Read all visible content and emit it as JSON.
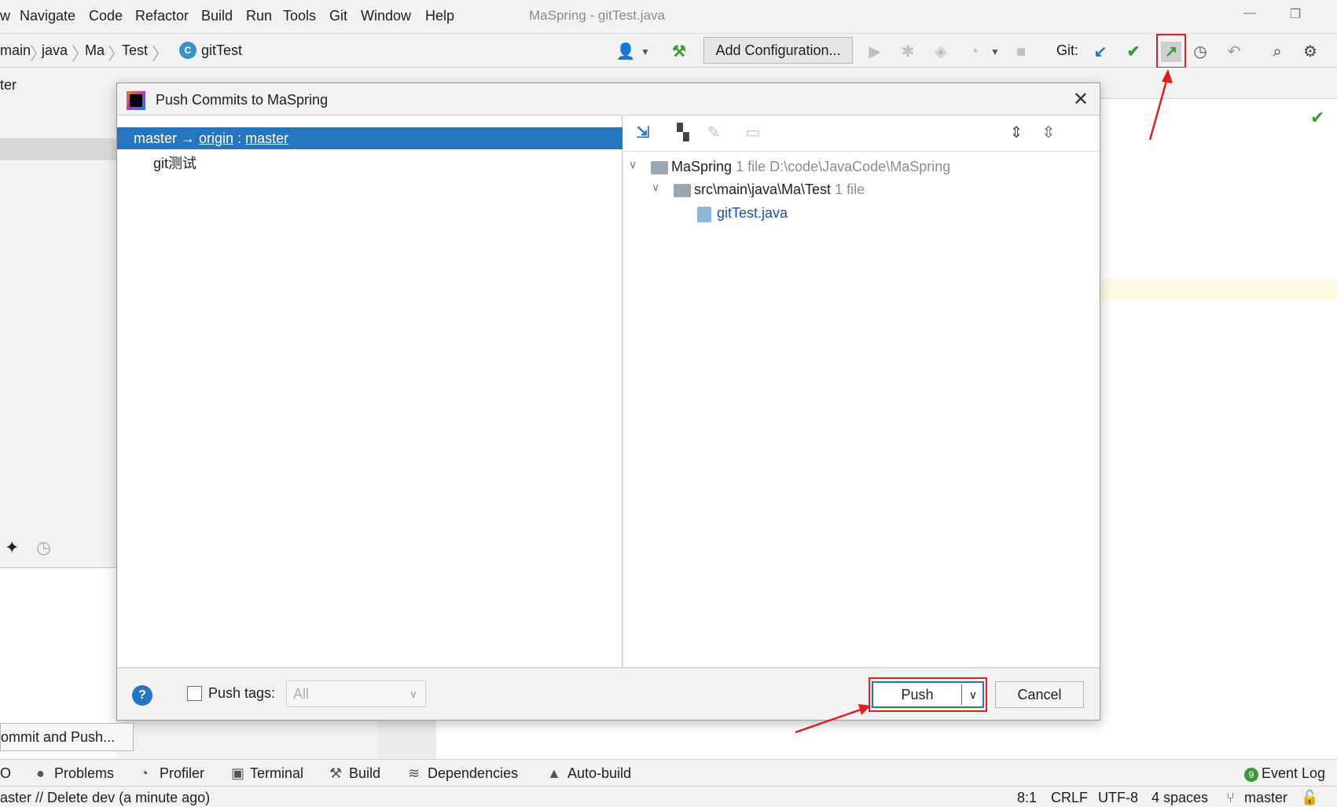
{
  "menu": {
    "items": [
      "w",
      "Navigate",
      "Code",
      "Refactor",
      "Build",
      "Run",
      "Tools",
      "Git",
      "Window",
      "Help"
    ],
    "window_title": "MaSpring - gitTest.java"
  },
  "breadcrumb": {
    "items": [
      "main",
      "java",
      "Ma",
      "Test",
      "gitTest"
    ]
  },
  "toolbar": {
    "add_configuration": "Add Configuration...",
    "git_label": "Git:"
  },
  "left_panel": {
    "tab_partial": "ter"
  },
  "dialog": {
    "title": "Push Commits to MaSpring",
    "branch": {
      "local": "master",
      "arrow": " → ",
      "remote": "origin",
      "colon": " : ",
      "remote_branch": "master"
    },
    "commits": [
      "git测试"
    ],
    "tree": {
      "root_name": "MaSpring",
      "root_count": "1 file",
      "root_path": "D:\\code\\JavaCode\\MaSpring",
      "folder_name": "src\\main\\java\\Ma\\Test",
      "folder_count": "1 file",
      "file_name": "gitTest.java"
    },
    "push_tags_label": "Push tags:",
    "push_tags_value": "All",
    "push_tags_checked": false,
    "push_button": "Push",
    "cancel_button": "Cancel"
  },
  "commit_and_push": "ommit and Push...",
  "tool_windows": {
    "items": [
      "O",
      "Problems",
      "Profiler",
      "Terminal",
      "Build",
      "Dependencies",
      "Auto-build"
    ],
    "event_log": "Event Log",
    "event_count": "9"
  },
  "status": {
    "message": "aster // Delete dev (a minute ago)",
    "position": "8:1",
    "line_sep": "CRLF",
    "encoding": "UTF-8",
    "indent": "4 spaces",
    "branch": "master"
  },
  "colors": {
    "accent": "#2675bf",
    "highlight_red": "#e02020",
    "git_green": "#3a9a3a"
  }
}
